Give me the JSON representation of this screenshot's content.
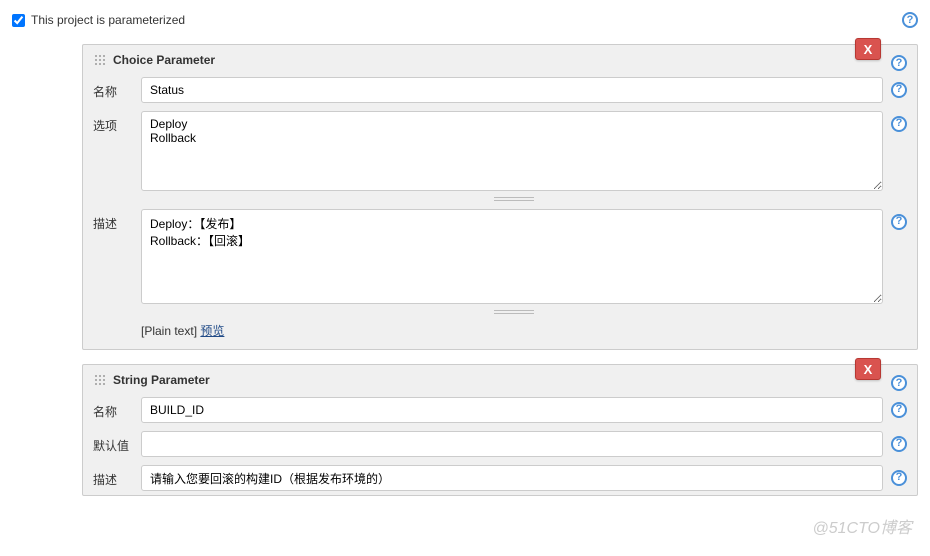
{
  "checkbox": {
    "label": "This project is parameterized",
    "checked": true
  },
  "params": [
    {
      "title": "Choice Parameter",
      "delete_label": "X",
      "fields": {
        "name_label": "名称",
        "name_value": "Status",
        "choices_label": "选项",
        "choices_value": "Deploy\nRollback",
        "desc_label": "描述",
        "desc_value": "Deploy：【发布】\nRollback：【回滚】"
      },
      "plain_text_label": "[Plain text]",
      "preview_label": "预览"
    },
    {
      "title": "String Parameter",
      "delete_label": "X",
      "fields": {
        "name_label": "名称",
        "name_value": "BUILD_ID",
        "default_label": "默认值",
        "default_value": "",
        "desc_label": "描述",
        "desc_value": "请输入您要回滚的构建ID（根据发布环境的）"
      }
    }
  ],
  "watermark": "@51CTO博客"
}
